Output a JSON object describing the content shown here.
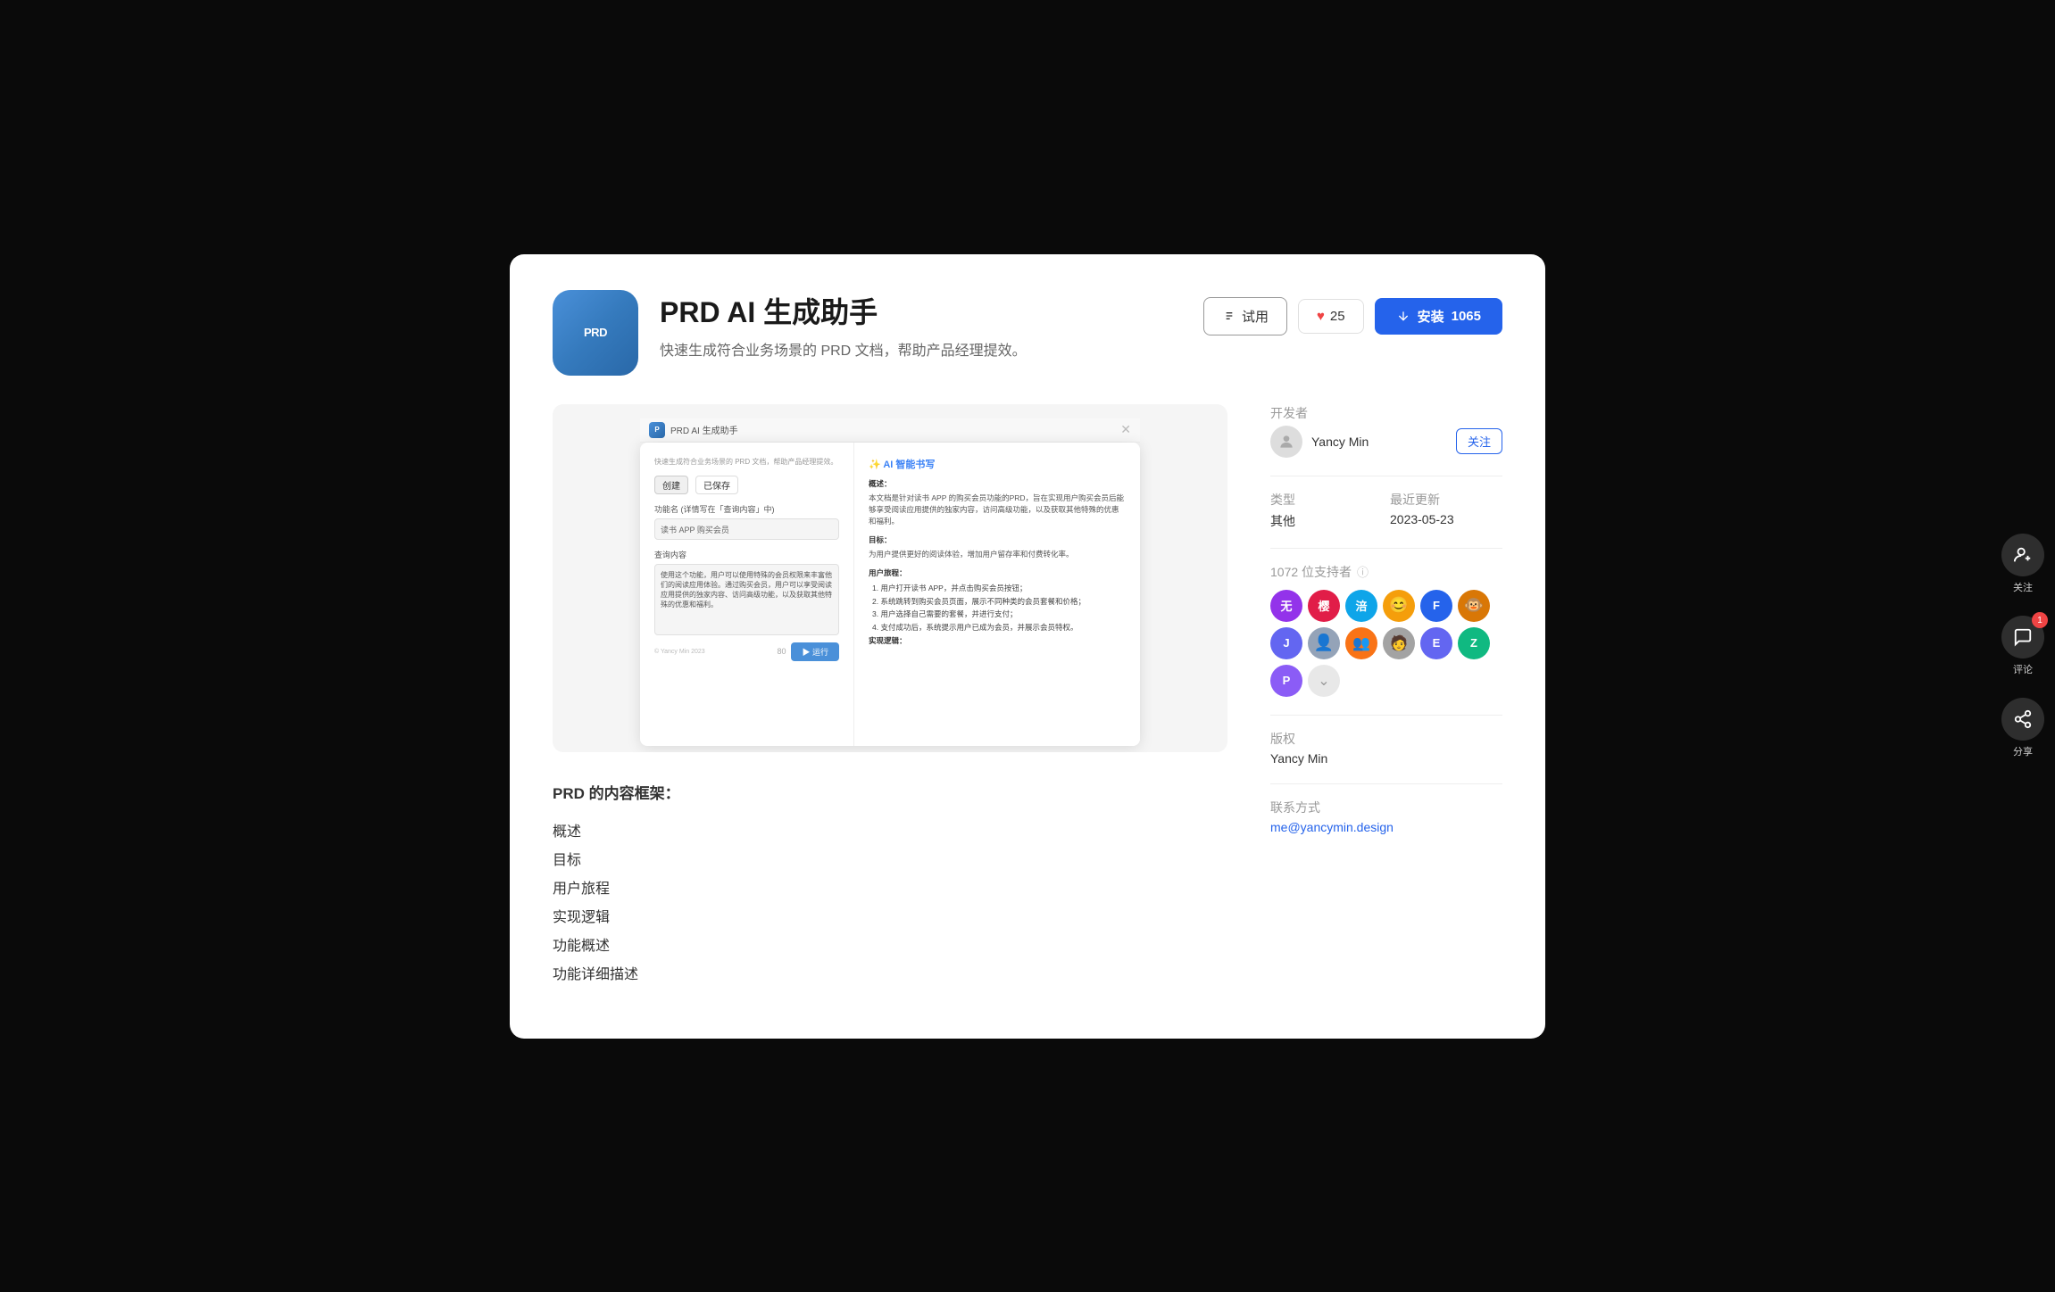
{
  "app": {
    "icon_text": "PRD",
    "title": "PRD AI 生成助手",
    "description": "快速生成符合业务场景的 PRD 文档，帮助产品经理提效。",
    "try_label": "试用",
    "like_count": "25",
    "install_label": "安装",
    "install_count": "1065"
  },
  "sidebar": {
    "developer_label": "开发者",
    "developer_name": "Yancy Min",
    "follow_label": "关注",
    "type_label": "类型",
    "type_value": "其他",
    "last_update_label": "最近更新",
    "last_update_value": "2023-05-23",
    "supporters_label": "1072 位支持者",
    "supporters_count": "1072",
    "copyright_label": "版权",
    "copyright_value": "Yancy Min",
    "contact_label": "联系方式",
    "contact_email": "me@yancymin.design",
    "avatars": [
      {
        "text": "无",
        "bg": "#9333ea"
      },
      {
        "text": "樱",
        "bg": "#e11d48"
      },
      {
        "text": "涪",
        "bg": "#0ea5e9"
      },
      {
        "text": "😊",
        "bg": "#f59e0b"
      },
      {
        "text": "F",
        "bg": "#2563eb"
      },
      {
        "text": "🐵",
        "bg": "#d97706"
      },
      {
        "text": "J",
        "bg": "#6366f1"
      },
      {
        "text": "👤",
        "bg": "#94a3b8"
      },
      {
        "text": "👥",
        "bg": "#f97316"
      },
      {
        "text": "🧑",
        "bg": "#a3a3a3"
      },
      {
        "text": "E",
        "bg": "#6366f1"
      },
      {
        "text": "Z",
        "bg": "#10b981"
      },
      {
        "text": "P",
        "bg": "#8b5cf6"
      }
    ]
  },
  "preview": {
    "app_name": "PRD AI 生成助手",
    "app_subtitle": "快速生成符合业务场景的 PRD 文档，帮助产品经理提效。",
    "tab_create": "创建",
    "tab_saved": "已保存",
    "function_label": "功能名 (详情写在「查询内容」中)",
    "function_placeholder": "读书 APP 购买会员",
    "query_label": "查询内容",
    "query_text": "使用这个功能，用户可以使用特殊的会员权限来丰富他们的阅读应用体验。通过购买会员，用户可以享受阅读应用提供的独家内容、访问高级功能，以及获取其他特殊的优惠和福利。",
    "token_count": "80",
    "run_label": "▶ 运行",
    "copyright": "© Yancy Min 2023",
    "right_header": "✨ AI 智能书写",
    "right_content_overview_title": "概述：",
    "right_content_overview": "本文档是针对读书 APP 的购买会员功能的PRD，旨在实现用户购买会员后能够享受阅读应用提供的独家内容，访问高级功能，以及获取其他特殊的优惠和福利。",
    "right_content_goal_title": "目标：",
    "right_content_goal": "为用户提供更好的阅读体验，增加用户留存率和付费转化率。",
    "right_content_journey_title": "用户旅程：",
    "journey_items": [
      "1. 用户打开读书 APP，并点击购买会员按钮；",
      "2. 系统跳转到购买会员页面，展示不同种类的会员套餐和价格；",
      "3. 用户选择自己需要的套餐，并进行支付；",
      "4. 支付成功后，系统提示用户已成为会员，并展示会员特权。"
    ],
    "right_content_logic_title": "实现逻辑："
  },
  "description": {
    "section_title": "PRD 的内容框架：",
    "items": [
      "概述",
      "目标",
      "用户旅程",
      "实现逻辑",
      "功能概述",
      "功能详细描述"
    ]
  },
  "right_sidebar": {
    "follow_label": "关注",
    "comment_label": "评论",
    "comment_count": "1",
    "share_label": "分享"
  }
}
